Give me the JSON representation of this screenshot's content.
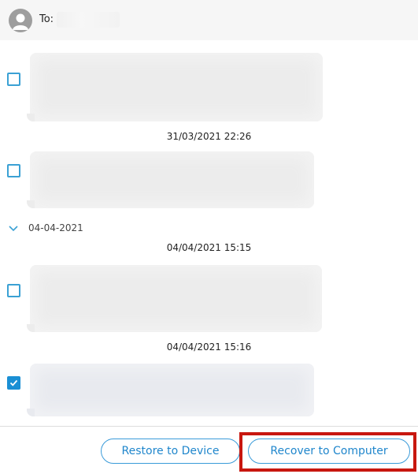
{
  "header": {
    "to_label": "To:",
    "avatar_icon": "person-icon"
  },
  "timestamps": {
    "t1": "31/03/2021 22:26",
    "t2": "04/04/2021 15:15",
    "t3": "04/04/2021 15:16"
  },
  "date_group": {
    "label": "04-04-2021",
    "icon": "chevron-down-icon",
    "expanded": true
  },
  "messages": [
    {
      "checked": false,
      "content": "blurred"
    },
    {
      "checked": false,
      "content": "blurred"
    },
    {
      "checked": false,
      "content": "blurred"
    },
    {
      "checked": true,
      "content": "blurred"
    }
  ],
  "footer": {
    "restore_label": "Restore to Device",
    "recover_label": "Recover to Computer"
  },
  "colors": {
    "accent": "#1a8fd4",
    "highlight": "#c8170f"
  }
}
